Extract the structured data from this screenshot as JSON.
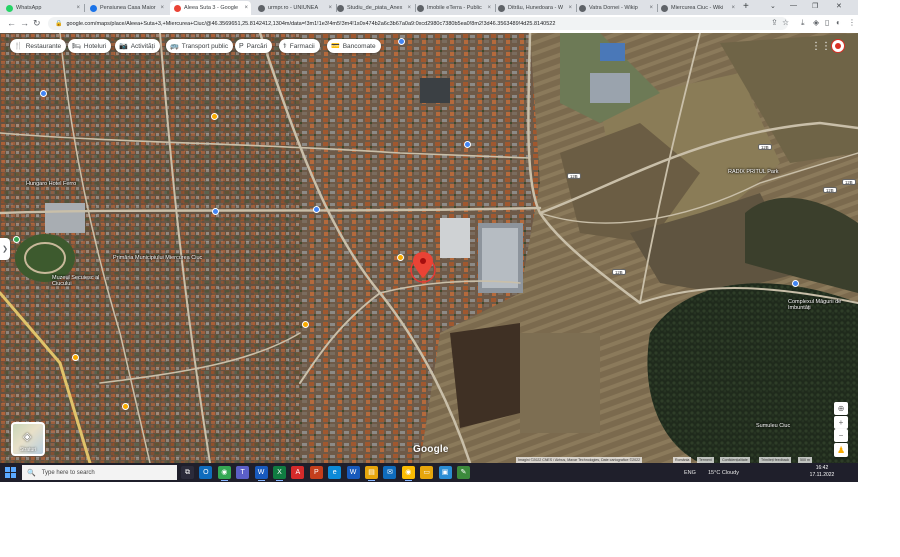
{
  "browser": {
    "tabs": [
      {
        "title": "WhatsApp",
        "color": "#25d366",
        "active": false
      },
      {
        "title": "Pensiunea Casa Maior",
        "color": "#1a73e8",
        "active": false
      },
      {
        "title": "Aleea Suta 3 - Google",
        "color": "#ea4335",
        "active": true
      },
      {
        "title": "urmpr.ro - UNIUNEA",
        "color": "#5f6368",
        "active": false
      },
      {
        "title": "Studiu_de_piata_Anex",
        "color": "#5f6368",
        "active": false
      },
      {
        "title": "Imobile eTerra - Public",
        "color": "#5f6368",
        "active": false
      },
      {
        "title": "Ditrău, Hunedoara - W",
        "color": "#5f6368",
        "active": false
      },
      {
        "title": "Vatra Dornei - Wikip",
        "color": "#5f6368",
        "active": false
      },
      {
        "title": "Miercurea Ciuc - Wiki",
        "color": "#5f6368",
        "active": false
      }
    ],
    "tab_close_glyph": "×",
    "new_tab_glyph": "+",
    "window_controls": [
      "⌄",
      "—",
      "❐",
      "✕"
    ],
    "url": "google.com/maps/place/Aleea+Suta+3,+Miercurea+Ciuc/@46.3569651,25.8142412,1304m/data=!3m1!1e3!4m5!3m4!1s0x474b2a6c3b67a0a9:0xcd2980c7380b5ea0!8m2!3d46.3563489!4d25.8140522",
    "nav": {
      "back": "←",
      "forward": "→",
      "reload": "↻"
    },
    "toolbar_icons": {
      "share": "⇪",
      "star": "☆",
      "extensions": "◈",
      "download": "⤓",
      "sidebar": "▯",
      "profile": "◐",
      "menu": "⋮"
    }
  },
  "map": {
    "categories": [
      {
        "label": "Restaurante",
        "icon": "🍴",
        "name": "restaurants"
      },
      {
        "label": "Hoteluri",
        "icon": "🛏",
        "name": "hotels"
      },
      {
        "label": "Activități",
        "icon": "📷",
        "name": "activities"
      },
      {
        "label": "Transport public",
        "icon": "🚌",
        "name": "public-transport"
      },
      {
        "label": "Parcări",
        "icon": "P",
        "name": "parking"
      },
      {
        "label": "Farmacii",
        "icon": "⚕",
        "name": "pharmacies"
      },
      {
        "label": "Bancomate",
        "icon": "💳",
        "name": "atms"
      }
    ],
    "places": [
      {
        "label": "Hungaro Hotel Ferro"
      },
      {
        "label": "Primăria Municipiului Miercurea Ciuc"
      },
      {
        "label": "Muzeul Secuiesc al Ciucului"
      },
      {
        "label": "RADIX PRITUL Park"
      },
      {
        "label": "Sumuleu Ciuc"
      },
      {
        "label": "Complexul Măgurii de Imbuntăți"
      }
    ],
    "road_shields": [
      "12B",
      "12B",
      "12B",
      "12B",
      "12B"
    ],
    "layers_label": "Straturi",
    "layers_icon": "◈",
    "logo": "Google",
    "controls": {
      "zoom_in": "+",
      "zoom_out": "−",
      "compass": "⊕",
      "pegman": "♟"
    },
    "side_toggle": "❯",
    "apps_icon": "⋮⋮",
    "attribution": {
      "imagery": "Imagini ©2022 CNES / Airbus, Maxar Technologies, Date cartografice ©2022",
      "links": [
        "România",
        "Termeni",
        "Confidențialitate",
        "Trimiteți feedback",
        "500 m"
      ]
    }
  },
  "taskbar": {
    "search_placeholder": "Type here to search",
    "search_icon": "🔍",
    "apps": [
      {
        "name": "task-view",
        "glyph": "⧉",
        "color": "#2b2b3a",
        "open": false
      },
      {
        "name": "outlook",
        "glyph": "O",
        "color": "#0f6cbd",
        "open": false
      },
      {
        "name": "chrome",
        "glyph": "◉",
        "color": "#34a853",
        "open": true
      },
      {
        "name": "teams",
        "glyph": "T",
        "color": "#5b5fc7",
        "open": false
      },
      {
        "name": "word",
        "glyph": "W",
        "color": "#185abd",
        "open": true
      },
      {
        "name": "excel",
        "glyph": "X",
        "color": "#107c41",
        "open": true
      },
      {
        "name": "acrobat",
        "glyph": "A",
        "color": "#d42a2a",
        "open": false
      },
      {
        "name": "powerpoint",
        "glyph": "P",
        "color": "#c43e1c",
        "open": false
      },
      {
        "name": "edge",
        "glyph": "e",
        "color": "#0c8ad8",
        "open": false
      },
      {
        "name": "word-2",
        "glyph": "W",
        "color": "#185abd",
        "open": false
      },
      {
        "name": "file-explorer",
        "glyph": "▤",
        "color": "#e6a50c",
        "open": true
      },
      {
        "name": "mail",
        "glyph": "✉",
        "color": "#0f6cbd",
        "open": false
      },
      {
        "name": "chrome-2",
        "glyph": "◉",
        "color": "#fbbc04",
        "open": true
      },
      {
        "name": "folder",
        "glyph": "▭",
        "color": "#e6a50c",
        "open": false
      },
      {
        "name": "photos",
        "glyph": "▣",
        "color": "#2a8dd4",
        "open": false
      },
      {
        "name": "sticky",
        "glyph": "✎",
        "color": "#3c8a3c",
        "open": false
      }
    ],
    "tray": {
      "language": "ENG",
      "weather": "15°C  Cloudy",
      "time": "16:42",
      "date": "17.11.2022"
    }
  }
}
